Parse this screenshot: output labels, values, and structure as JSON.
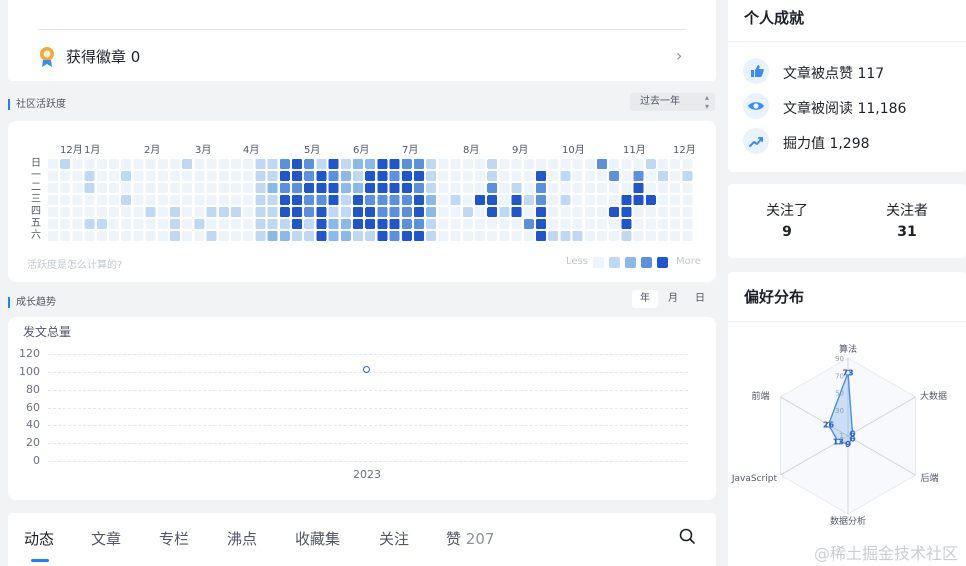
{
  "badge": {
    "label": "获得徽章 0"
  },
  "activity": {
    "section_title": "社区活跃度",
    "range_select": "过去一年",
    "months": [
      "12月",
      "1月",
      "2月",
      "3月",
      "4月",
      "5月",
      "6月",
      "7月",
      "8月",
      "9月",
      "10月",
      "11月",
      "12月"
    ],
    "weekdays": [
      "日",
      "一",
      "二",
      "三",
      "四",
      "五",
      "六"
    ],
    "help_link": "活跃度是怎么计算的?",
    "legend_less": "Less",
    "legend_more": "More",
    "level_colors": [
      "#eef4fb",
      "#bfd9f5",
      "#8ab9ec",
      "#5b8fe0",
      "#1f56cf"
    ]
  },
  "growth": {
    "section_title": "成长趋势",
    "periods": [
      "年",
      "月",
      "日"
    ],
    "active_period": "年",
    "chart_data": {
      "type": "line",
      "title": "发文总量",
      "xlabel": "",
      "ylabel": "",
      "x": [
        "2023"
      ],
      "series": [
        {
          "values": [
            102
          ]
        }
      ],
      "ylim": [
        0,
        120
      ],
      "yticks": [
        0,
        20,
        40,
        60,
        80,
        100,
        120
      ],
      "grid": true
    }
  },
  "tabs": {
    "items": [
      "动态",
      "文章",
      "专栏",
      "沸点",
      "收藏集",
      "关注",
      "赞"
    ],
    "like_count": "207",
    "active": "动态"
  },
  "achievements": {
    "title": "个人成就",
    "items": [
      {
        "icon": "thumbs-up-icon",
        "text": "文章被点赞 117"
      },
      {
        "icon": "eye-icon",
        "text": "文章被阅读 11,186"
      },
      {
        "icon": "trend-up-icon",
        "text": "掘力值 1,298"
      }
    ]
  },
  "follow": {
    "following_label": "关注了",
    "following_count": "9",
    "followers_label": "关注者",
    "followers_count": "31"
  },
  "preference": {
    "title": "偏好分布",
    "chart_data": {
      "type": "radar",
      "axes": [
        "算法",
        "大数据",
        "后端",
        "数据分析",
        "JavaScript",
        "前端"
      ],
      "values": [
        73,
        6,
        6,
        9,
        13,
        26
      ],
      "rlim": [
        0,
        90
      ],
      "rticks": [
        1,
        10,
        20,
        30,
        40,
        50,
        60,
        70,
        80,
        90
      ],
      "ring_labels": [
        "1",
        "30",
        "50",
        "70",
        "90"
      ],
      "color": "#4a90e2"
    }
  },
  "watermark": "@稀土掘金技术社区"
}
